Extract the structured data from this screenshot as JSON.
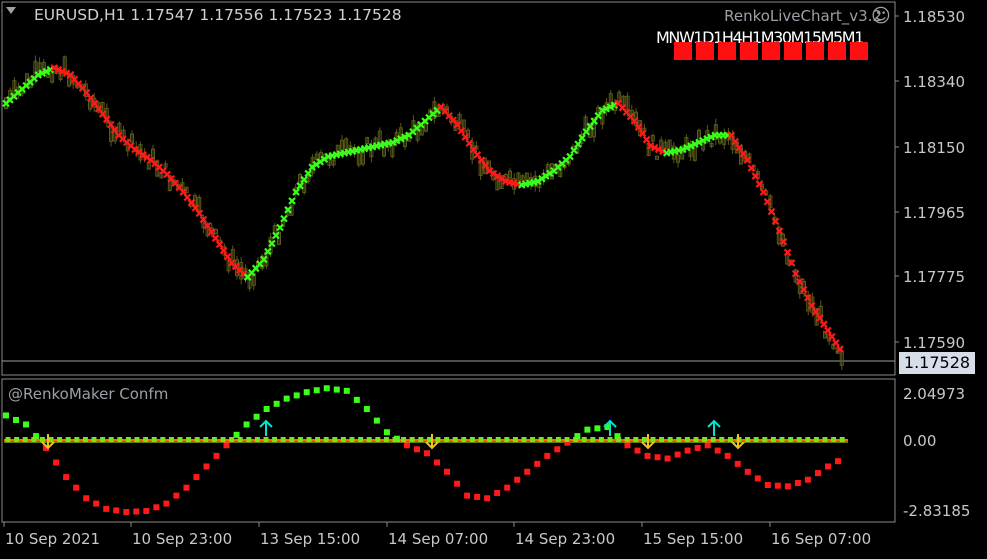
{
  "header": {
    "symbol_line": "EURUSD,H1  1.17547 1.17556 1.17523 1.17528",
    "brand": "RenkoLiveChart_v3.2",
    "smile_icon": "☺"
  },
  "timeframes": {
    "labels": "MNW1D1H4H1M30M15M5M1",
    "items": [
      "MN",
      "W1",
      "D1",
      "H4",
      "H1",
      "M30",
      "M15",
      "M5",
      "M1"
    ],
    "box_color": "#ff1010"
  },
  "main_axis": {
    "ticks": [
      "1.18530",
      "1.18340",
      "1.18150",
      "1.17965",
      "1.17775",
      "1.17590"
    ],
    "current_price": "1.17528"
  },
  "sub_window": {
    "name": "@RenkoMaker Confm",
    "ticks": [
      "2.04973",
      "0.00",
      "-2.83185"
    ]
  },
  "time_axis": {
    "labels": [
      "10 Sep 2021",
      "10 Sep 23:00",
      "13 Sep 15:00",
      "14 Sep 07:00",
      "14 Sep 23:00",
      "15 Sep 15:00",
      "16 Sep 07:00"
    ]
  },
  "colors": {
    "bull_marker": "#39ff1a",
    "bear_marker": "#ff1a1a",
    "candle": "#5a5a1a",
    "signal_up": "#00e5d0",
    "signal_down": "#f0c020",
    "zero_line": "#ff6a00"
  },
  "chart_data": [
    {
      "type": "line",
      "title": "EURUSD,H1",
      "series": [
        {
          "values": [
            1.1828,
            1.1832,
            1.1836,
            1.1838,
            1.1836,
            1.1831,
            1.1825,
            1.1819,
            1.1815,
            1.1812,
            1.1808,
            1.1803,
            1.1797,
            1.179,
            1.1783,
            1.1779,
            1.1784,
            1.1793,
            1.1803,
            1.181,
            1.1813,
            1.1814,
            1.1815,
            1.1816,
            1.1817,
            1.1819,
            1.1823,
            1.1827,
            1.1822,
            1.1815,
            1.1809,
            1.1806,
            1.1805,
            1.1806,
            1.1809,
            1.1813,
            1.182,
            1.1826,
            1.1828,
            1.1823,
            1.1816,
            1.1814,
            1.1815,
            1.1817,
            1.1819,
            1.1819,
            1.1812,
            1.1803,
            1.1792,
            1.178,
            1.1771,
            1.1764,
            1.1757
          ]
        }
      ],
      "ylim": [
        1.1752,
        1.1856
      ]
    },
    {
      "type": "line",
      "title": "@RenkoMaker Confm",
      "series": [
        {
          "values": [
            0.95,
            0.6,
            -0.3,
            -1.4,
            -2.2,
            -2.6,
            -2.72,
            -2.68,
            -2.4,
            -1.8,
            -1.0,
            -0.2,
            0.6,
            1.2,
            1.6,
            1.85,
            2.0,
            1.9,
            1.2,
            0.3,
            -0.2,
            -0.5,
            -1.2,
            -2.1,
            -2.2,
            -1.8,
            -1.2,
            -0.6,
            -0.1,
            0.4,
            0.5,
            -0.2,
            -0.6,
            -0.7,
            -0.4,
            -0.2,
            -0.6,
            -1.2,
            -1.7,
            -1.75,
            -1.5,
            -1.0,
            -0.6
          ]
        }
      ],
      "ylim": [
        -2.83185,
        2.04973
      ]
    }
  ]
}
